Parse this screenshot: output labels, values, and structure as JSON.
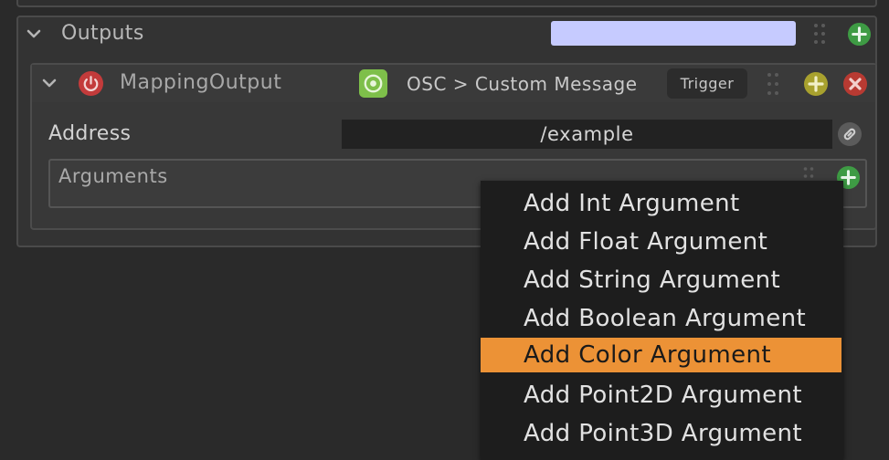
{
  "outputs": {
    "title": "Outputs",
    "color": "#c6cbff"
  },
  "mapping_output": {
    "title": "MappingOutput",
    "protocol_label": "OSC > Custom Message",
    "trigger_label": "Trigger"
  },
  "address": {
    "label": "Address",
    "value": "/example"
  },
  "arguments": {
    "label": "Arguments"
  },
  "context_menu": {
    "items": [
      "Add Int Argument",
      "Add Float Argument",
      "Add String Argument",
      "Add Boolean Argument",
      "Add Color Argument",
      "Add Point2D Argument",
      "Add Point3D Argument"
    ],
    "highlighted_index": 4,
    "highlight_color": "#ec9236"
  },
  "icons": {
    "add": "plus-circle-icon",
    "remove": "x-circle-icon",
    "power": "power-icon",
    "osc": "osc-icon",
    "link": "link-icon",
    "handle": "drag-handle-icon",
    "collapse": "chevron-down-icon"
  }
}
